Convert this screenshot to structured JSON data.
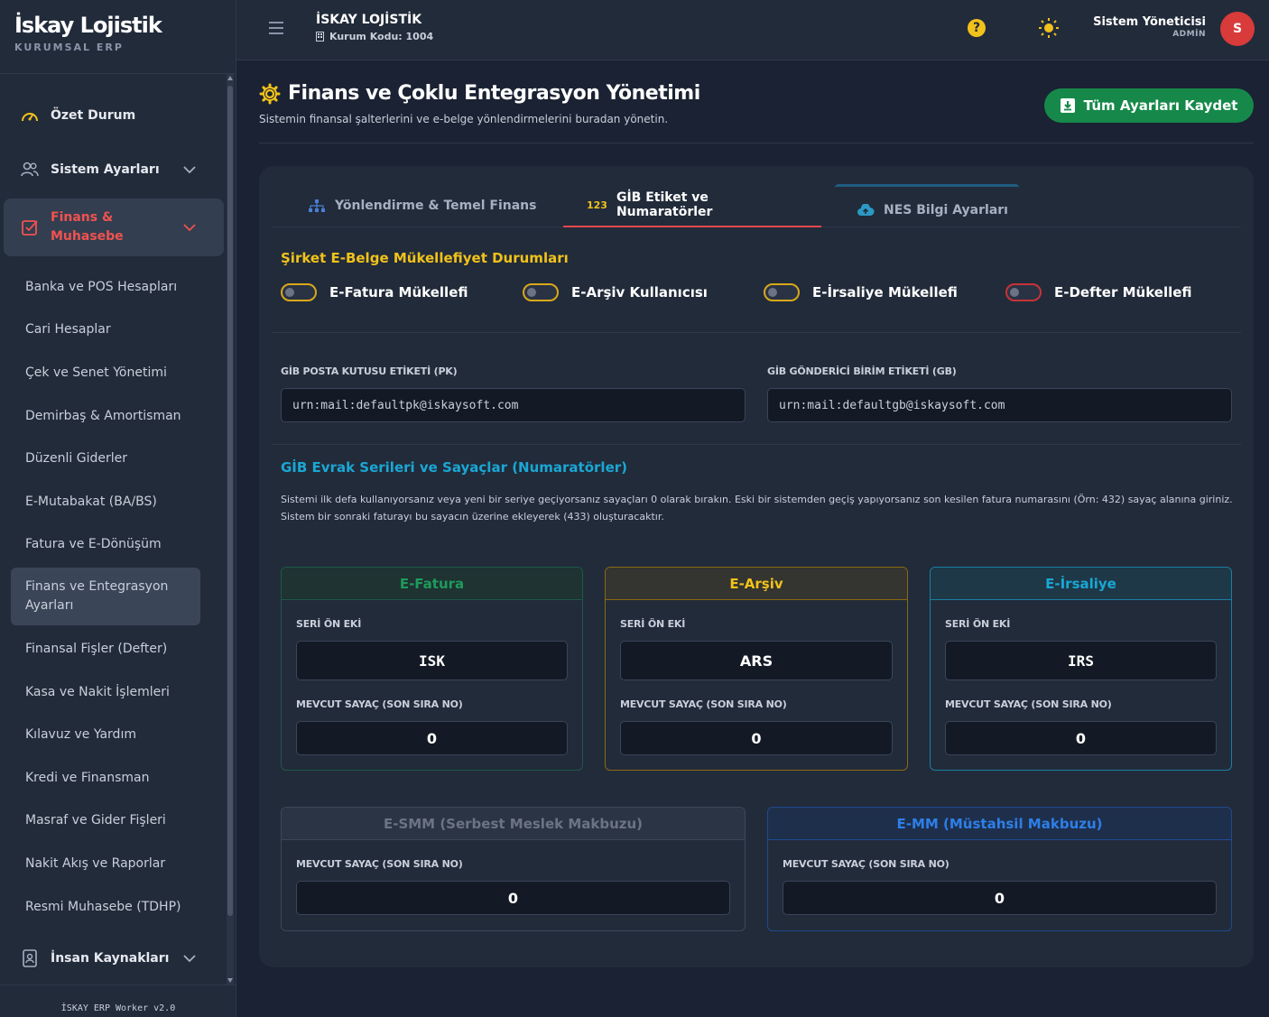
{
  "brand": {
    "title": "İskay Lojistik",
    "subtitle": "KURUMSAL ERP"
  },
  "sidebar": {
    "main_items": [
      {
        "label": "Özet Durum"
      },
      {
        "label": "Sistem Ayarları"
      },
      {
        "label": "Finans & Muhasebe"
      },
      {
        "label": "İnsan Kaynakları"
      }
    ],
    "finance_items": [
      "Banka ve POS Hesapları",
      "Cari Hesaplar",
      "Çek ve Senet Yönetimi",
      "Demirbaş & Amortisman",
      "Düzenli Giderler",
      "E-Mutabakat (BA/BS)",
      "Fatura ve E-Dönüşüm",
      "Finans ve Entegrasyon Ayarları",
      "Finansal Fişler (Defter)",
      "Kasa ve Nakit İşlemleri",
      "Kılavuz ve Yardım",
      "Kredi ve Finansman",
      "Masraf ve Gider Fişleri",
      "Nakit Akış ve Raporlar",
      "Resmi Muhasebe (TDHP)"
    ],
    "active_finance_index": 7,
    "footer": "İSKAY ERP Worker v2.0"
  },
  "topbar": {
    "org_name": "İSKAY LOJİSTİK",
    "org_code": "Kurum Kodu: 1004",
    "user_name": "Sistem Yöneticisi",
    "user_role": "ADMİN",
    "avatar_letter": "S"
  },
  "page": {
    "title": "Finans ve Çoklu Entegrasyon Yönetimi",
    "subtitle": "Sistemin finansal şalterlerini ve e-belge yönlendirmelerini buradan yönetin.",
    "save_label": "Tüm Ayarları Kaydet"
  },
  "tabs": [
    {
      "label": "Yönlendirme & Temel Finans",
      "active": false
    },
    {
      "badge": "123",
      "label": "GİB Etiket ve Numaratörler",
      "active": true
    },
    {
      "label": "NES Bilgi Ayarları",
      "active": false
    }
  ],
  "status_section": {
    "title": "Şirket E-Belge Mükellefiyet Durumları",
    "toggles": [
      {
        "label": "E-Fatura Mükellefi",
        "on": false
      },
      {
        "label": "E-Arşiv Kullanıcısı",
        "on": false
      },
      {
        "label": "E-İrsaliye Mükellefi",
        "on": false
      },
      {
        "label": "E-Defter Mükellefi",
        "on": false
      }
    ]
  },
  "gib": {
    "pk_label": "GİB POSTA KUTUSU ETİKETİ (PK)",
    "pk_value": "urn:mail:defaultpk@iskaysoft.com",
    "gb_label": "GİB GÖNDERİCİ BİRİM ETİKETİ (GB)",
    "gb_value": "urn:mail:defaultgb@iskaysoft.com"
  },
  "series_section": {
    "title": "GİB Evrak Serileri ve Sayaçlar (Numaratörler)",
    "info": "Sistemi ilk defa kullanıyorsanız veya yeni bir seriye geçiyorsanız sayaçları 0 olarak bırakın. Eski bir sistemden geçiş yapıyorsanız son kesilen fatura numarasını (Örn: 432) sayaç alanına giriniz. Sistem bir sonraki faturayı bu sayacın üzerine ekleyerek (433) oluşturacaktır.",
    "prefix_label": "SERİ ÖN EKİ",
    "counter_label": "MEVCUT SAYAÇ (SON SIRA NO)",
    "cards": [
      {
        "title": "E-Fatura",
        "prefix": "ISK",
        "counter": "0"
      },
      {
        "title": "E-Arşiv",
        "prefix": "ARS",
        "counter": "0"
      },
      {
        "title": "E-İrsaliye",
        "prefix": "IRS",
        "counter": "0"
      },
      {
        "title": "E-SMM (Serbest Meslek Makbuzu)",
        "counter": "0"
      },
      {
        "title": "E-MM (Müstahsil Makbuzu)",
        "counter": "0"
      }
    ]
  },
  "colors": {
    "efatura": "#1f9a5c",
    "earsiv": "#d9a81a",
    "eirsaliye": "#1aa7d4",
    "esmm": "#4c5568",
    "emm": "#2e6fd8",
    "danger": "#e8484a",
    "success": "#16894a"
  }
}
